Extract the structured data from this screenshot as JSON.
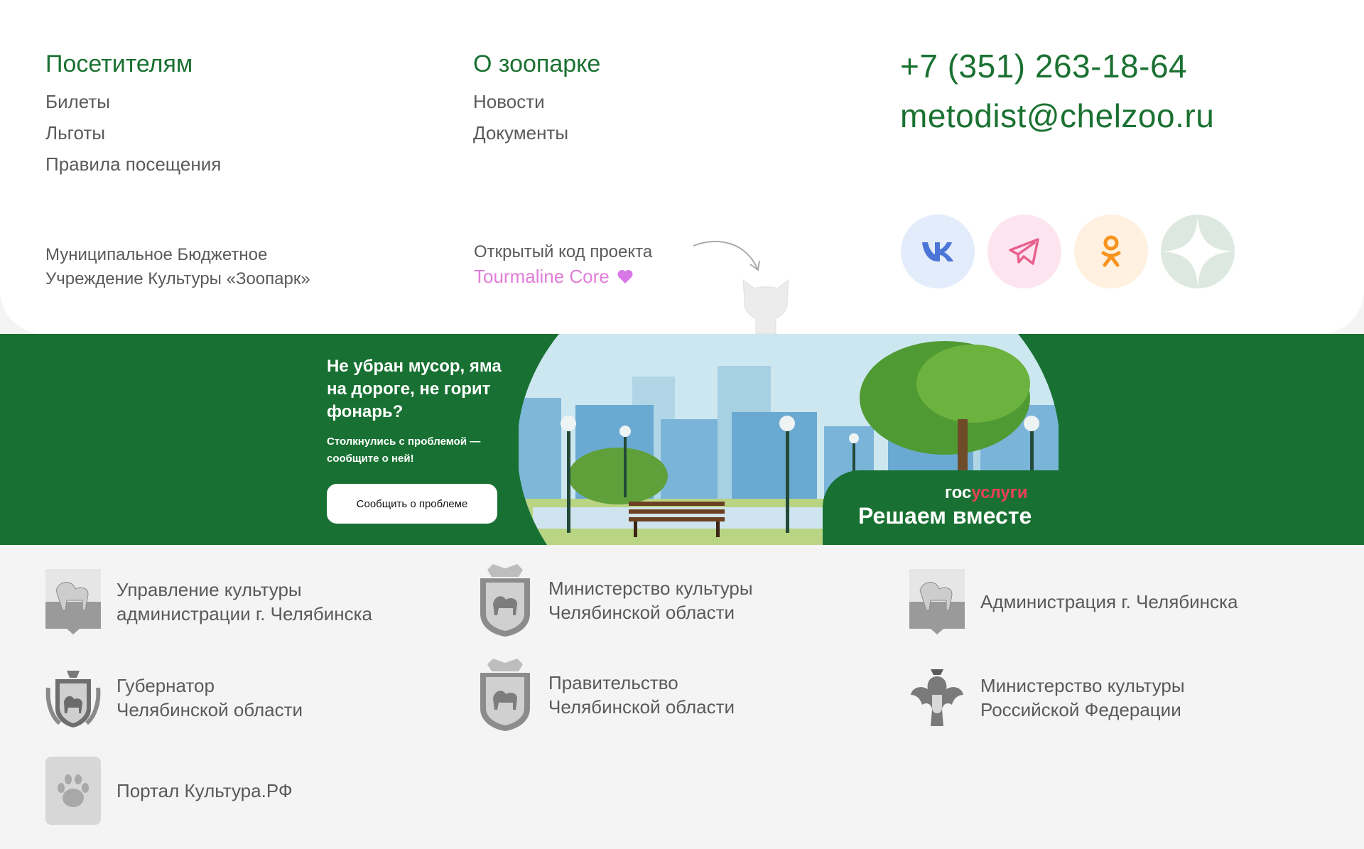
{
  "visitors": {
    "title": "Посетителям",
    "links": [
      "Билеты",
      "Льготы",
      "Правила посещения"
    ]
  },
  "about": {
    "title": "О зоопарке",
    "links": [
      "Новости",
      "Документы"
    ]
  },
  "contacts": {
    "phone": "+7 (351) 263-18-64",
    "email": "metodist@chelzoo.ru"
  },
  "org": {
    "line1": "Муниципальное Бюджетное",
    "line2": "Учреждение Культуры «Зоопарк»"
  },
  "open_source": {
    "label": "Открытый код проекта",
    "link": "Tourmaline Core"
  },
  "socials": [
    {
      "name": "vk-icon",
      "color": "#4c75d8"
    },
    {
      "name": "telegram-icon",
      "color": "#e8608e"
    },
    {
      "name": "odnoklassniki-icon",
      "color": "#f7931e"
    },
    {
      "name": "dzen-icon",
      "color": "#dde9e0"
    }
  ],
  "banner": {
    "title": "Не убран мусор, яма на дороге, не горит фонарь?",
    "subtitle": "Столкнулись с проблемой — сообщите о ней!",
    "button": "Сообщить о проблеме",
    "logo_part1": "гос",
    "logo_part2": "услуги",
    "tagline": "Решаем вместе"
  },
  "partners": [
    {
      "line1": "Управление культуры",
      "line2": "администрации г. Челябинска"
    },
    {
      "line1": "Министерство культуры",
      "line2": "Челябинской области"
    },
    {
      "line1": "Администрация г. Челябинска",
      "line2": ""
    },
    {
      "line1": "Губернатор",
      "line2": "Челябинской области"
    },
    {
      "line1": "Правительство",
      "line2": "Челябинской области"
    },
    {
      "line1": "Министерство культуры",
      "line2": "Российской Федерации"
    },
    {
      "line1": "Портал Культура.РФ",
      "line2": ""
    }
  ],
  "colors": {
    "brand_green": "#1a7131",
    "banner_green": "#187132",
    "accent_pink": "#e27cd9",
    "gos_red": "#ee3f58"
  }
}
